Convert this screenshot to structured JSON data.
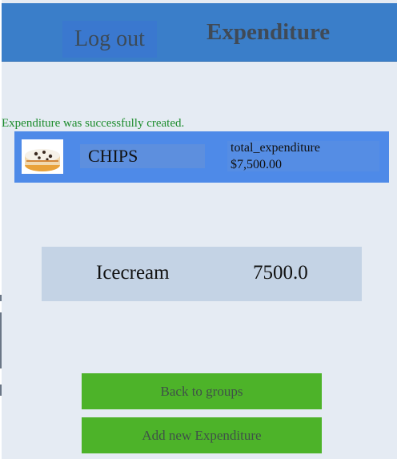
{
  "header": {
    "logout_label": "Log out",
    "title": "Expenditure"
  },
  "notice": "Expenditure was successfully created.",
  "group": {
    "name": "CHIPS",
    "total_label": "total_expenditure",
    "total_value": "$7,500.00",
    "thumbnail_icon": "cake-image"
  },
  "expenses": [
    {
      "name": "Icecream",
      "amount": "7500.0"
    }
  ],
  "actions": {
    "back_label": "Back to groups",
    "add_label": "Add new Expenditure"
  },
  "colors": {
    "header_bg": "#3a7ec9",
    "card_bg": "#4e8ae8",
    "button_bg": "#4db329",
    "notice_text": "#1c8c2c",
    "page_bg": "#e5ebf3"
  }
}
